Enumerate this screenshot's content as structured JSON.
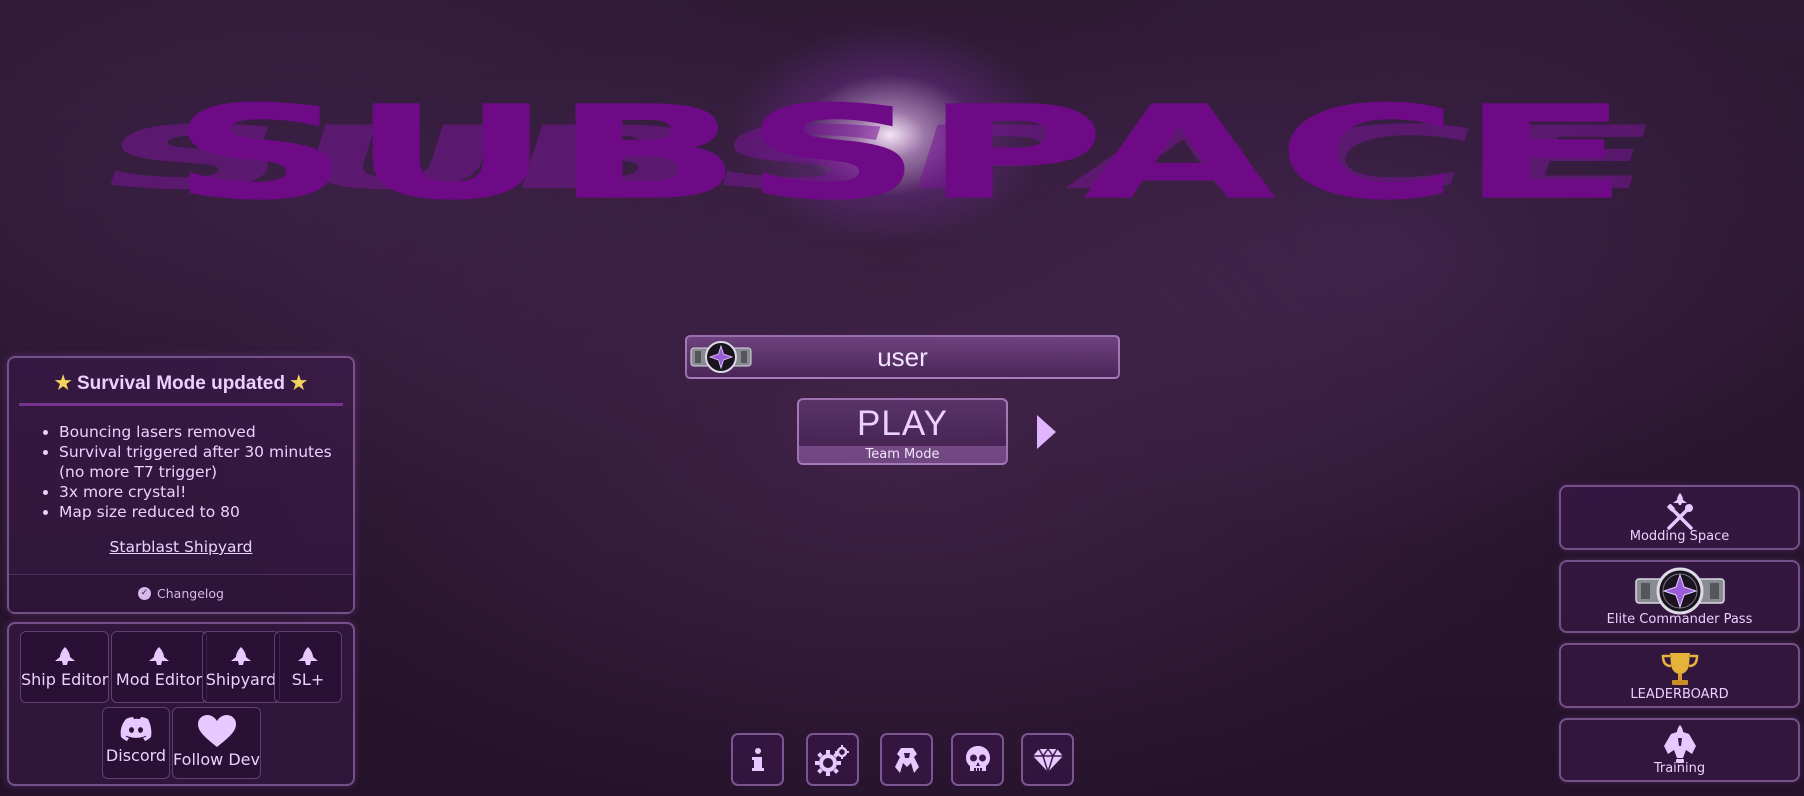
{
  "logo": {
    "text": "SUBSPACE"
  },
  "news": {
    "title": "Survival Mode updated",
    "items": [
      "Bouncing lasers removed",
      "Survival triggered after 30 minutes (no more T7 trigger)",
      "3x more crystal!",
      "Map size reduced to 80"
    ],
    "link": "Starblast Shipyard",
    "changelog": "Changelog"
  },
  "tools": {
    "ship_editor": "Ship Editor",
    "mod_editor": "Mod Editor",
    "shipyard": "Shipyard",
    "sl_plus": "SL+",
    "discord": "Discord",
    "follow_dev": "Follow Dev"
  },
  "player": {
    "name": "user"
  },
  "play": {
    "label": "PLAY",
    "mode": "Team Mode"
  },
  "bottom_icons": [
    "info-icon",
    "settings-icon",
    "ship-icon",
    "skull-icon",
    "gem-icon"
  ],
  "side": {
    "modding": "Modding Space",
    "elite": "Elite Commander Pass",
    "leaderboard": "LEADERBOARD",
    "training": "Training"
  },
  "colors": {
    "accent": "#6e0a86",
    "text": "#ecd0ff",
    "gold": "#f3d35c"
  }
}
